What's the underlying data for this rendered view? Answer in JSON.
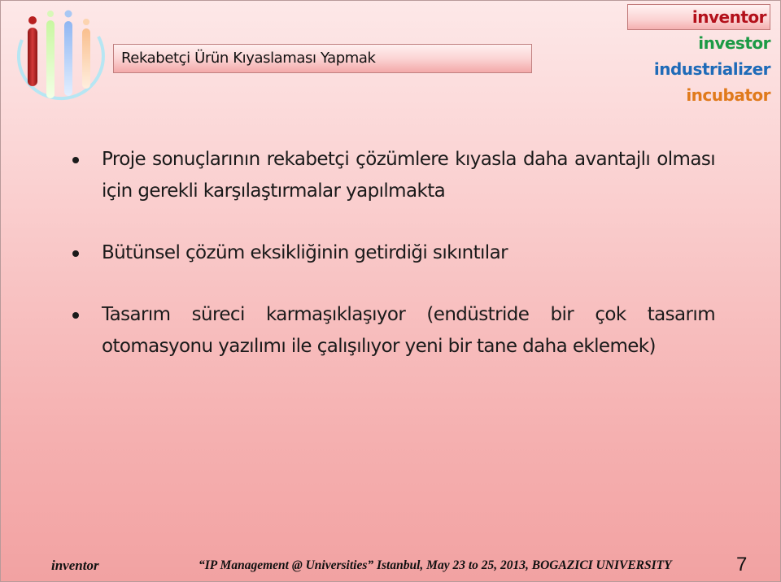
{
  "header": {
    "title": "Rekabetçi Ürün Kıyaslaması Yapmak",
    "logo_icon": "four-i-pillars-logo-icon"
  },
  "brand_list": [
    {
      "label": "inventor",
      "color": "#b3101a",
      "highlighted": true
    },
    {
      "label": "investor",
      "color": "#1c9a45",
      "highlighted": false
    },
    {
      "label": "industrializer",
      "color": "#1f6bb8",
      "highlighted": false
    },
    {
      "label": "incubator",
      "color": "#e07a1c",
      "highlighted": false
    }
  ],
  "bullets": [
    {
      "text": "Proje sonuçlarının rekabetçi çözümlere kıyasla daha avantajlı olması için gerekli karşılaştırmalar yapılmakta"
    },
    {
      "text": "Bütünsel çözüm eksikliğinin getirdiği sıkıntılar"
    },
    {
      "text": "Tasarım süreci karmaşıklaşıyor (endüstride bir çok tasarım otomasyonu yazılımı ile çalışılıyor yeni bir tane daha eklemek)"
    }
  ],
  "footer": {
    "left": "inventor",
    "middle": "“IP Management @ Universities” Istanbul, May 23 to 25,  2013, BOGAZICI UNIVERSITY",
    "page_number": "7"
  }
}
